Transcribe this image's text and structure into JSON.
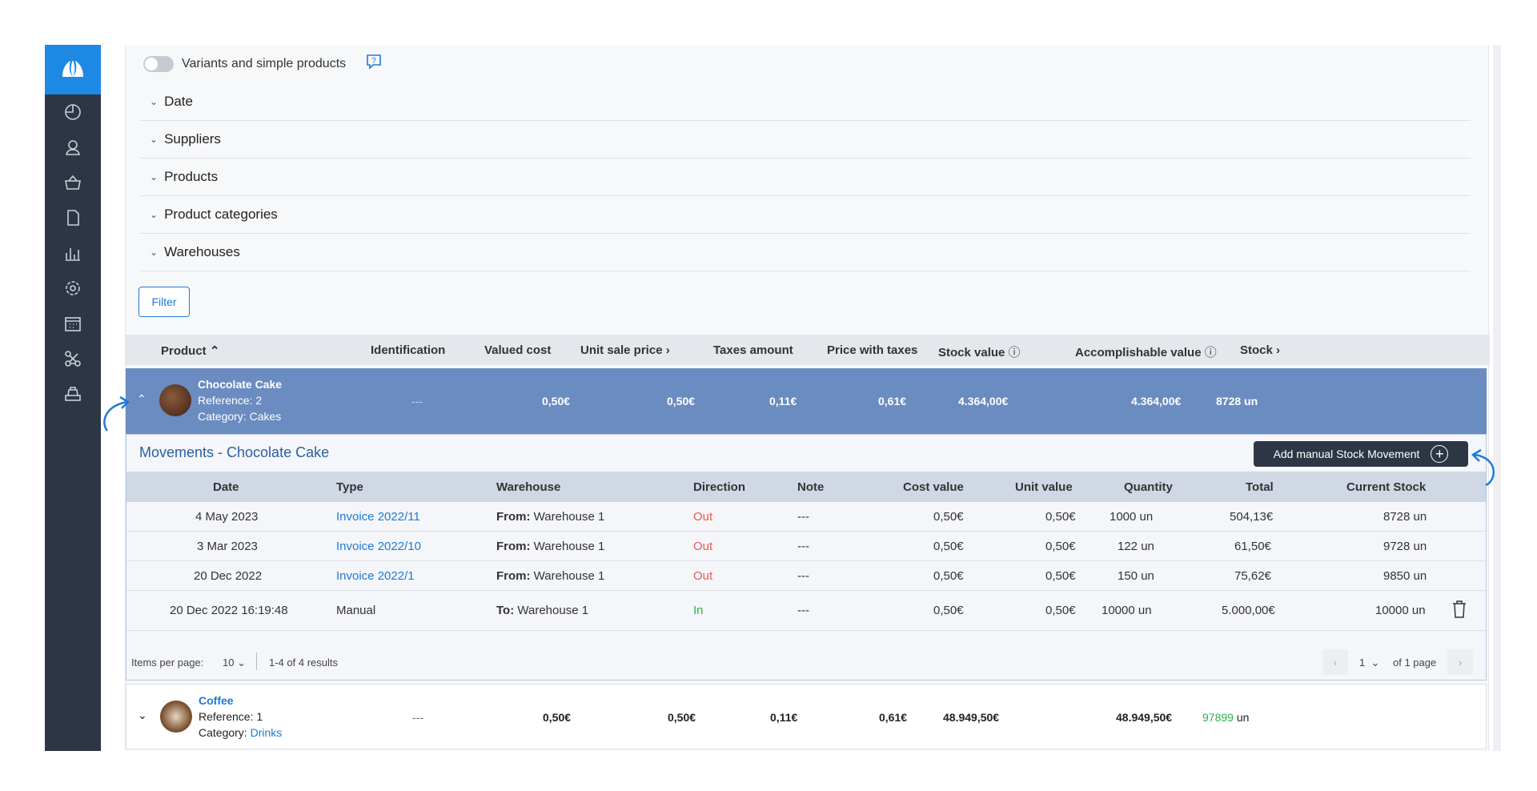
{
  "sidebar": {
    "logo_icon": "leaf-logo-icon",
    "items": [
      {
        "icon": "dashboard-icon"
      },
      {
        "icon": "user-icon"
      },
      {
        "icon": "basket-icon"
      },
      {
        "icon": "document-icon"
      },
      {
        "icon": "bar-chart-icon"
      },
      {
        "icon": "gear-icon"
      },
      {
        "icon": "calendar-icon"
      },
      {
        "icon": "integrations-icon"
      },
      {
        "icon": "cash-register-icon"
      }
    ]
  },
  "toolbar": {
    "variants_label": "Variants and simple products",
    "variants_toggle_on": false,
    "help_icon": "help-chat-icon"
  },
  "filters": {
    "sections": [
      "Date",
      "Suppliers",
      "Products",
      "Product categories",
      "Warehouses"
    ],
    "filter_button": "Filter"
  },
  "table": {
    "headers": {
      "product": "Product",
      "identification": "Identification",
      "valued_cost": "Valued cost",
      "unit_sale_price": "Unit sale price",
      "taxes_amount": "Taxes amount",
      "price_with_taxes": "Price with taxes",
      "stock_value": "Stock value",
      "accomplishable_value": "Accomplishable value",
      "stock": "Stock"
    },
    "rows": [
      {
        "name": "Chocolate Cake",
        "reference": "Reference: 2",
        "category_prefix": "Category: ",
        "category": "Cakes",
        "identification": "---",
        "valued_cost": "0,50€",
        "unit_sale_price": "0,50€",
        "taxes_amount": "0,11€",
        "price_with_taxes": "0,61€",
        "stock_value": "4.364,00€",
        "accomplishable_value": "4.364,00€",
        "stock_qty": "8728",
        "stock_unit": " un"
      },
      {
        "name": "Coffee",
        "reference": "Reference: 1",
        "category_prefix": "Category: ",
        "category": "Drinks",
        "identification": "---",
        "valued_cost": "0,50€",
        "unit_sale_price": "0,50€",
        "taxes_amount": "0,11€",
        "price_with_taxes": "0,61€",
        "stock_value": "48.949,50€",
        "accomplishable_value": "48.949,50€",
        "stock_qty": "97899",
        "stock_unit": " un"
      }
    ]
  },
  "movements": {
    "title": "Movements - Chocolate Cake",
    "add_button": "Add manual Stock Movement",
    "headers": {
      "date": "Date",
      "type": "Type",
      "warehouse": "Warehouse",
      "direction": "Direction",
      "note": "Note",
      "cost_value": "Cost value",
      "unit_value": "Unit value",
      "quantity": "Quantity",
      "total": "Total",
      "current_stock": "Current Stock"
    },
    "rows": [
      {
        "date": "4 May 2023",
        "type": "Invoice 2022/11",
        "wh_prefix": "From:",
        "warehouse": " Warehouse 1",
        "direction": "Out",
        "note": "---",
        "cost_value": "0,50€",
        "unit_value": "0,50€",
        "quantity": "1000 un",
        "total": "504,13€",
        "current_stock": "8728 un"
      },
      {
        "date": "3 Mar 2023",
        "type": "Invoice 2022/10",
        "wh_prefix": "From:",
        "warehouse": " Warehouse 1",
        "direction": "Out",
        "note": "---",
        "cost_value": "0,50€",
        "unit_value": "0,50€",
        "quantity": "122 un",
        "total": "61,50€",
        "current_stock": "9728 un"
      },
      {
        "date": "20 Dec 2022",
        "type": "Invoice 2022/1",
        "wh_prefix": "From:",
        "warehouse": " Warehouse 1",
        "direction": "Out",
        "note": "---",
        "cost_value": "0,50€",
        "unit_value": "0,50€",
        "quantity": "150 un",
        "total": "75,62€",
        "current_stock": "9850 un"
      },
      {
        "date": "20 Dec 2022 16:19:48",
        "type": "Manual",
        "wh_prefix": "To:",
        "warehouse": " Warehouse 1",
        "direction": "In",
        "note": "---",
        "cost_value": "0,50€",
        "unit_value": "0,50€",
        "quantity": "10000 un",
        "total": "5.000,00€",
        "current_stock": "10000 un"
      }
    ],
    "pager": {
      "items_per_page_label": "Items per page:",
      "items_per_page": "10",
      "results": "1-4 of 4 results",
      "page": "1",
      "of_pages": "of 1 page"
    }
  },
  "colors": {
    "accent": "#1e7ad6",
    "sidebar": "#2d3645",
    "selected_row": "#6a8cc0",
    "out": "#e85a4f",
    "in": "#2ab24a"
  }
}
